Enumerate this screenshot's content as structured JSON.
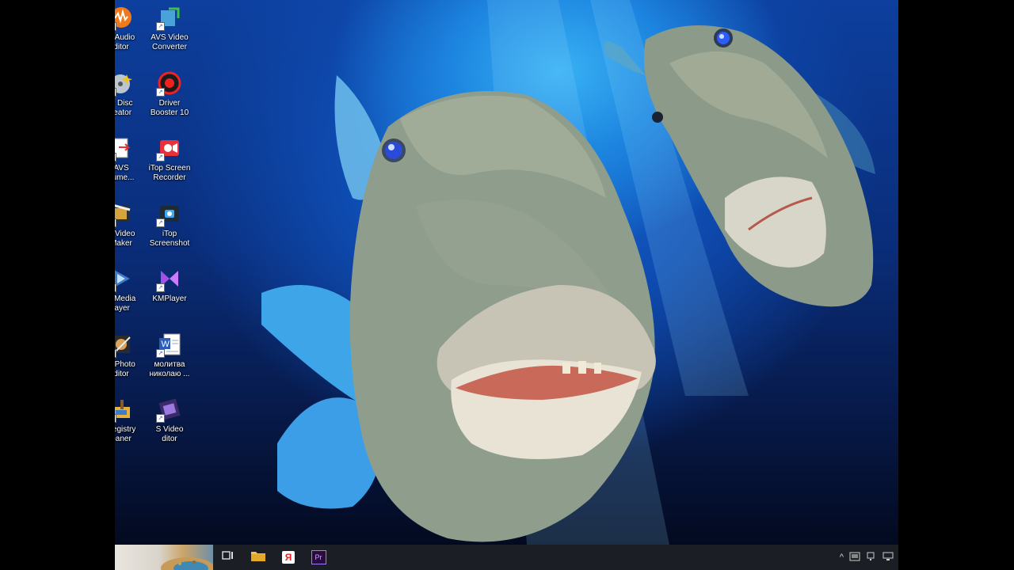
{
  "desktop": {
    "icons": [
      {
        "label": "S Audio\nditor",
        "icon": "avs-audio-editor-icon"
      },
      {
        "label": "AVS Video\nConverter",
        "icon": "avs-video-converter-icon"
      },
      {
        "label": "S Disc\nreator",
        "icon": "avs-disc-creator-icon"
      },
      {
        "label": "Driver\nBooster 10",
        "icon": "driver-booster-icon"
      },
      {
        "label": "AVS\ncume...",
        "icon": "avs-document-converter-icon"
      },
      {
        "label": "iTop Screen\nRecorder",
        "icon": "itop-screen-recorder-icon"
      },
      {
        "label": "S Video\nMaker",
        "icon": "avs-video-maker-icon"
      },
      {
        "label": "iTop\nScreenshot",
        "icon": "itop-screenshot-icon"
      },
      {
        "label": "S Media\nlayer",
        "icon": "avs-media-player-icon"
      },
      {
        "label": "KMPlayer",
        "icon": "kmplayer-icon"
      },
      {
        "label": "S Photo\nditor",
        "icon": "avs-photo-editor-icon"
      },
      {
        "label": "молитва\nниколаю ...",
        "icon": "word-document-icon"
      },
      {
        "label": "Registry\neaner",
        "icon": "avs-registry-cleaner-icon"
      },
      {
        "label": "S Video\nditor",
        "icon": "avs-video-editor-icon"
      }
    ]
  },
  "taskbar": {
    "pinned": [
      {
        "name": "task-view-icon"
      },
      {
        "name": "file-explorer-icon"
      },
      {
        "name": "yandex-browser-icon",
        "glyph": "Я"
      },
      {
        "name": "premiere-pro-icon",
        "glyph": "Pr"
      }
    ],
    "tray": [
      {
        "name": "show-hidden-icons-icon",
        "glyph": "^"
      },
      {
        "name": "tray-app-icon"
      },
      {
        "name": "tray-device-icon"
      },
      {
        "name": "network-icon"
      }
    ]
  },
  "colors": {
    "taskbar": "#1b1e24",
    "water_light": "#39b2f4",
    "water_deep": "#071a4a",
    "premiere_purple": "#9a7cff"
  }
}
